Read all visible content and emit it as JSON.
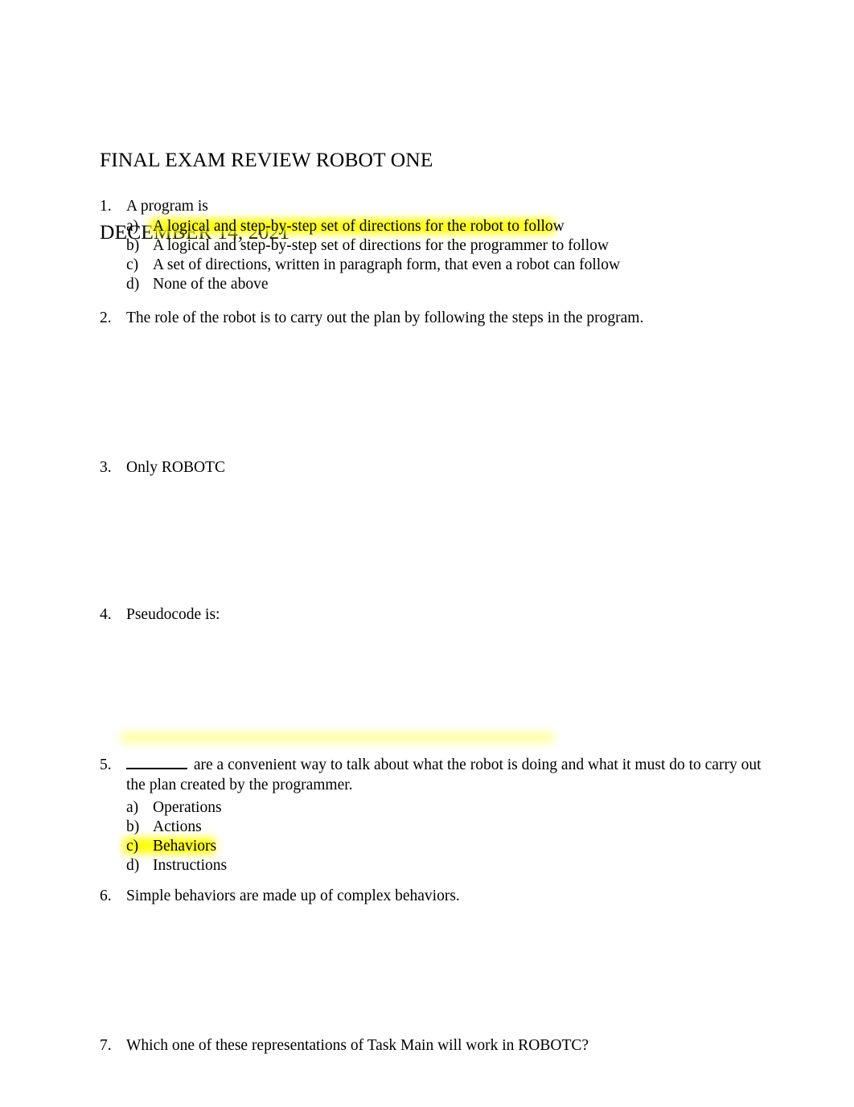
{
  "document": {
    "title_lines": [
      "FINAL EXAM REVIEW ROBOT ONE",
      "DECEMBER 14, 2021"
    ],
    "highlight_color": "#ffff00",
    "text_color": "#000000",
    "background_color": "#ffffff"
  },
  "questions": [
    {
      "number": "1.",
      "text": "A program is",
      "options": [
        {
          "letter": "a)",
          "text": "A logical and step-by-step set of directions for the robot to follow",
          "highlighted": "yes"
        },
        {
          "letter": "b)",
          "text": "A logical and step-by-step set of directions for the programmer to follow",
          "highlighted": "no"
        },
        {
          "letter": "c)",
          "text": "A set of directions, written in paragraph form, that even a robot can follow",
          "highlighted": "no"
        },
        {
          "letter": "d)",
          "text": "None of the above",
          "highlighted": "no"
        }
      ]
    },
    {
      "number": "2.",
      "text": "The role of the robot is to carry out the plan by following the steps in the program.",
      "options": []
    },
    {
      "number": "3.",
      "text": "Only ROBOTC",
      "options": []
    },
    {
      "number": "4.",
      "text": "Pseudocode is:",
      "options": []
    },
    {
      "number": "5.",
      "blank_prefix": "________",
      "text_after_blank": " are a convenient way to talk about what the robot is doing and what it must do to carry out the plan created by the programmer.",
      "options": [
        {
          "letter": "a)",
          "text": "Operations",
          "highlighted": "no"
        },
        {
          "letter": "b)",
          "text": "Actions",
          "highlighted": "no"
        },
        {
          "letter": "c)",
          "text": "Behaviors",
          "highlighted": "yes"
        },
        {
          "letter": "d)",
          "text": "Instructions",
          "highlighted": "no"
        }
      ]
    },
    {
      "number": "6.",
      "text": "Simple behaviors are made up of complex behaviors.",
      "options": []
    },
    {
      "number": "7.",
      "text": "Which one of these representations of Task Main will work in ROBOTC?",
      "options": []
    }
  ]
}
